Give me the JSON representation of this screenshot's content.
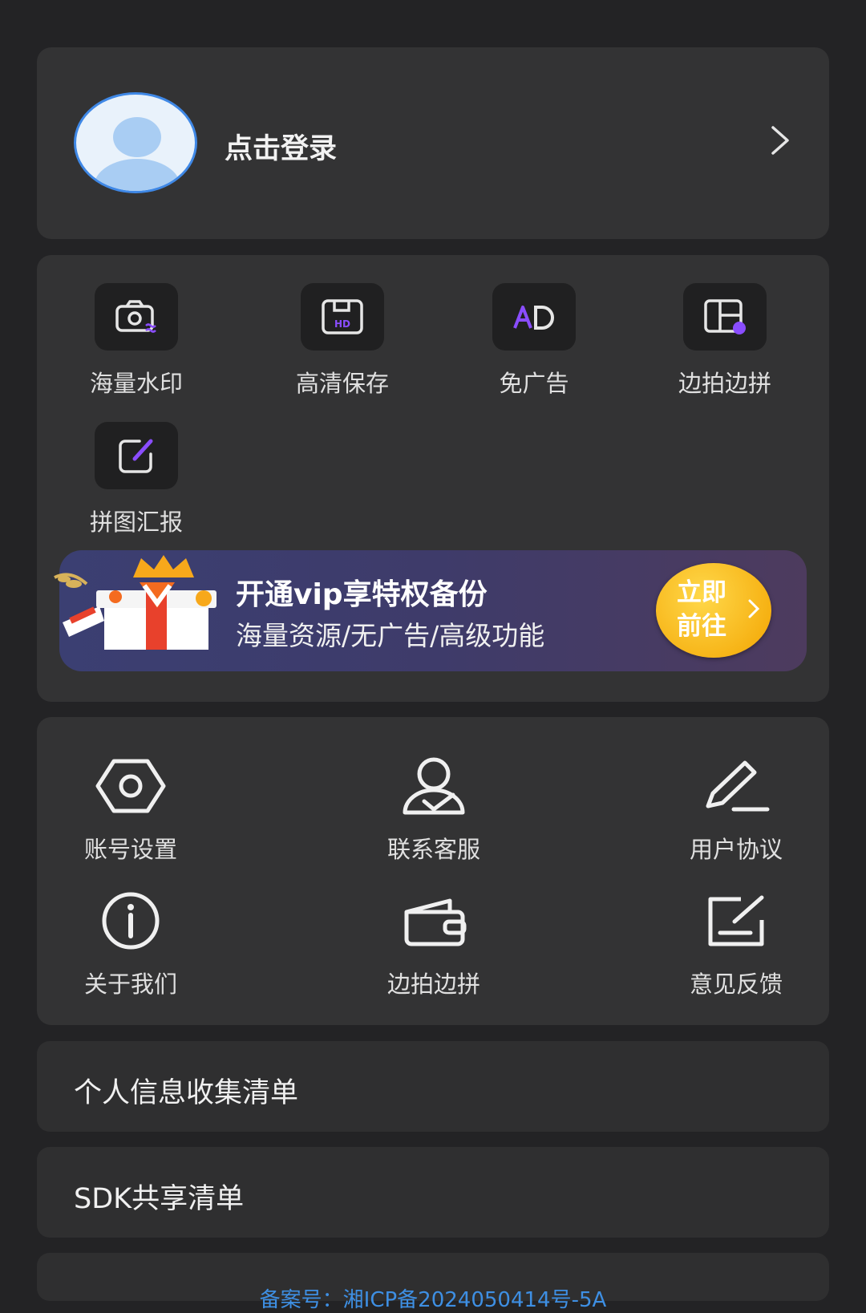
{
  "login": {
    "label": "点击登录"
  },
  "vip_features": [
    {
      "label": "海量水印",
      "icon": "camera-watermark-icon"
    },
    {
      "label": "高清保存",
      "icon": "hd-save-icon"
    },
    {
      "label": "免广告",
      "icon": "ad-free-icon"
    },
    {
      "label": "边拍边拼",
      "icon": "layout-collage-icon"
    },
    {
      "label": "拼图汇报",
      "icon": "edit-report-icon"
    }
  ],
  "banner": {
    "title": "开通vip享特权备份",
    "subtitle": "海量资源/无广告/高级功能",
    "button": "立即前往"
  },
  "settings": [
    {
      "label": "账号设置",
      "icon": "settings-hexagon-icon"
    },
    {
      "label": "联系客服",
      "icon": "customer-service-icon"
    },
    {
      "label": "用户协议",
      "icon": "pen-icon"
    },
    {
      "label": "关于我们",
      "icon": "info-icon"
    },
    {
      "label": "边拍边拼",
      "icon": "wallet-icon"
    },
    {
      "label": "意见反馈",
      "icon": "feedback-icon"
    }
  ],
  "rows": {
    "personal_info": "个人信息收集清单",
    "sdk_share": "SDK共享清单"
  },
  "footer": {
    "icp": "备案号：湘ICP备2024050414号-5A"
  },
  "colors": {
    "background": "#232325",
    "card": "#333334",
    "accent": "#8a4dff",
    "link": "#3e8fe3",
    "vip_button": "#f3a400"
  }
}
